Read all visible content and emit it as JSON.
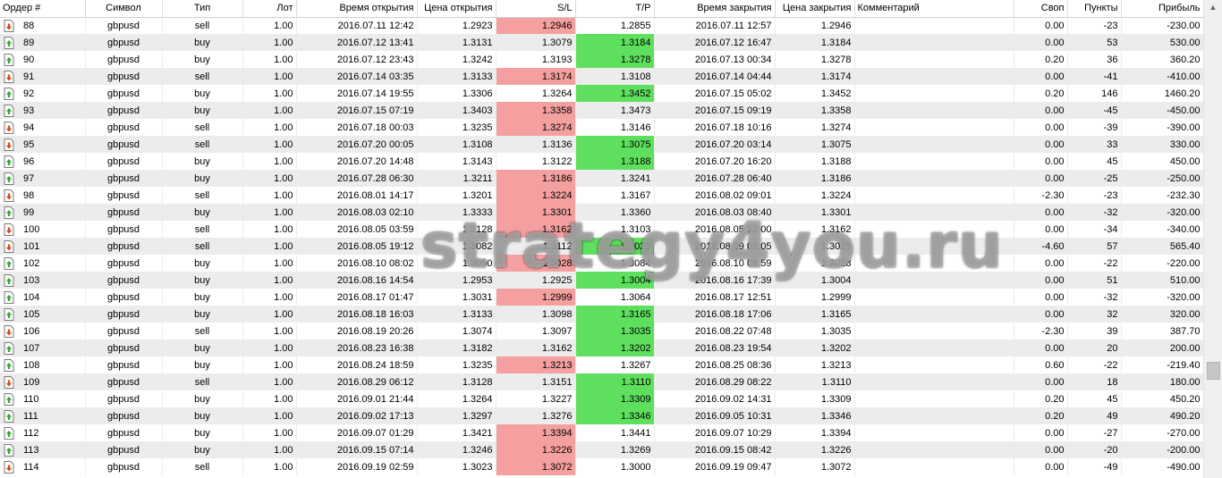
{
  "columns": [
    "Ордер #",
    "Символ",
    "Тип",
    "Лот",
    "Время открытия",
    "Цена открытия",
    "S/L",
    "T/P",
    "Время закрытия",
    "Цена закрытия",
    "Комментарий",
    "Своп",
    "Пункты",
    "Прибыль"
  ],
  "colors": {
    "sl_hit": "#f5a0a0",
    "tp_hit": "#5ee05e",
    "row_alt": "#ececec"
  },
  "icons": {
    "buy": "arrow-up-order-icon",
    "sell": "arrow-down-order-icon"
  },
  "watermark": "strategy4you.ru",
  "rows": [
    {
      "order": "88",
      "symbol": "gbpusd",
      "type": "sell",
      "lot": "1.00",
      "open_time": "2016.07.11 12:42",
      "open_price": "1.2923",
      "sl": "1.2946",
      "tp": "1.2855",
      "close_time": "2016.07.11 12:57",
      "close_price": "1.2946",
      "comment": "",
      "swap": "0.00",
      "points": "-23",
      "profit": "-230.00",
      "hit": "sl"
    },
    {
      "order": "89",
      "symbol": "gbpusd",
      "type": "buy",
      "lot": "1.00",
      "open_time": "2016.07.12 13:41",
      "open_price": "1.3131",
      "sl": "1.3079",
      "tp": "1.3184",
      "close_time": "2016.07.12 16:47",
      "close_price": "1.3184",
      "comment": "",
      "swap": "0.00",
      "points": "53",
      "profit": "530.00",
      "hit": "tp"
    },
    {
      "order": "90",
      "symbol": "gbpusd",
      "type": "buy",
      "lot": "1.00",
      "open_time": "2016.07.12 23:43",
      "open_price": "1.3242",
      "sl": "1.3193",
      "tp": "1.3278",
      "close_time": "2016.07.13 00:34",
      "close_price": "1.3278",
      "comment": "",
      "swap": "0.20",
      "points": "36",
      "profit": "360.20",
      "hit": "tp"
    },
    {
      "order": "91",
      "symbol": "gbpusd",
      "type": "sell",
      "lot": "1.00",
      "open_time": "2016.07.14 03:35",
      "open_price": "1.3133",
      "sl": "1.3174",
      "tp": "1.3108",
      "close_time": "2016.07.14 04:44",
      "close_price": "1.3174",
      "comment": "",
      "swap": "0.00",
      "points": "-41",
      "profit": "-410.00",
      "hit": "sl"
    },
    {
      "order": "92",
      "symbol": "gbpusd",
      "type": "buy",
      "lot": "1.00",
      "open_time": "2016.07.14 19:55",
      "open_price": "1.3306",
      "sl": "1.3264",
      "tp": "1.3452",
      "close_time": "2016.07.15 05:02",
      "close_price": "1.3452",
      "comment": "",
      "swap": "0.20",
      "points": "146",
      "profit": "1460.20",
      "hit": "tp"
    },
    {
      "order": "93",
      "symbol": "gbpusd",
      "type": "buy",
      "lot": "1.00",
      "open_time": "2016.07.15 07:19",
      "open_price": "1.3403",
      "sl": "1.3358",
      "tp": "1.3473",
      "close_time": "2016.07.15 09:19",
      "close_price": "1.3358",
      "comment": "",
      "swap": "0.00",
      "points": "-45",
      "profit": "-450.00",
      "hit": "sl"
    },
    {
      "order": "94",
      "symbol": "gbpusd",
      "type": "sell",
      "lot": "1.00",
      "open_time": "2016.07.18 00:03",
      "open_price": "1.3235",
      "sl": "1.3274",
      "tp": "1.3146",
      "close_time": "2016.07.18 10:16",
      "close_price": "1.3274",
      "comment": "",
      "swap": "0.00",
      "points": "-39",
      "profit": "-390.00",
      "hit": "sl"
    },
    {
      "order": "95",
      "symbol": "gbpusd",
      "type": "sell",
      "lot": "1.00",
      "open_time": "2016.07.20 00:05",
      "open_price": "1.3108",
      "sl": "1.3136",
      "tp": "1.3075",
      "close_time": "2016.07.20 03:14",
      "close_price": "1.3075",
      "comment": "",
      "swap": "0.00",
      "points": "33",
      "profit": "330.00",
      "hit": "tp"
    },
    {
      "order": "96",
      "symbol": "gbpusd",
      "type": "buy",
      "lot": "1.00",
      "open_time": "2016.07.20 14:48",
      "open_price": "1.3143",
      "sl": "1.3122",
      "tp": "1.3188",
      "close_time": "2016.07.20 16:20",
      "close_price": "1.3188",
      "comment": "",
      "swap": "0.00",
      "points": "45",
      "profit": "450.00",
      "hit": "tp"
    },
    {
      "order": "97",
      "symbol": "gbpusd",
      "type": "buy",
      "lot": "1.00",
      "open_time": "2016.07.28 06:30",
      "open_price": "1.3211",
      "sl": "1.3186",
      "tp": "1.3241",
      "close_time": "2016.07.28 06:40",
      "close_price": "1.3186",
      "comment": "",
      "swap": "0.00",
      "points": "-25",
      "profit": "-250.00",
      "hit": "sl"
    },
    {
      "order": "98",
      "symbol": "gbpusd",
      "type": "sell",
      "lot": "1.00",
      "open_time": "2016.08.01 14:17",
      "open_price": "1.3201",
      "sl": "1.3224",
      "tp": "1.3167",
      "close_time": "2016.08.02 09:01",
      "close_price": "1.3224",
      "comment": "",
      "swap": "-2.30",
      "points": "-23",
      "profit": "-232.30",
      "hit": "sl"
    },
    {
      "order": "99",
      "symbol": "gbpusd",
      "type": "buy",
      "lot": "1.00",
      "open_time": "2016.08.03 02:10",
      "open_price": "1.3333",
      "sl": "1.3301",
      "tp": "1.3360",
      "close_time": "2016.08.03 08:40",
      "close_price": "1.3301",
      "comment": "",
      "swap": "0.00",
      "points": "-32",
      "profit": "-320.00",
      "hit": "sl"
    },
    {
      "order": "100",
      "symbol": "gbpusd",
      "type": "sell",
      "lot": "1.00",
      "open_time": "2016.08.05 03:59",
      "open_price": "1.3128",
      "sl": "1.3162",
      "tp": "1.3103",
      "close_time": "2016.08.05 12:00",
      "close_price": "1.3162",
      "comment": "",
      "swap": "0.00",
      "points": "-34",
      "profit": "-340.00",
      "hit": "sl"
    },
    {
      "order": "101",
      "symbol": "gbpusd",
      "type": "sell",
      "lot": "1.00",
      "open_time": "2016.08.05 19:12",
      "open_price": "1.3082",
      "sl": "1.3112",
      "tp": "1.3025",
      "close_time": "2016.08.09 02:05",
      "close_price": "1.3025",
      "comment": "",
      "swap": "-4.60",
      "points": "57",
      "profit": "565.40",
      "hit": "tp"
    },
    {
      "order": "102",
      "symbol": "gbpusd",
      "type": "buy",
      "lot": "1.00",
      "open_time": "2016.08.10 08:02",
      "open_price": "1.3050",
      "sl": "1.3028",
      "tp": "1.3084",
      "close_time": "2016.08.10 08:59",
      "close_price": "1.3028",
      "comment": "",
      "swap": "0.00",
      "points": "-22",
      "profit": "-220.00",
      "hit": "sl"
    },
    {
      "order": "103",
      "symbol": "gbpusd",
      "type": "buy",
      "lot": "1.00",
      "open_time": "2016.08.16 14:54",
      "open_price": "1.2953",
      "sl": "1.2925",
      "tp": "1.3004",
      "close_time": "2016.08.16 17:39",
      "close_price": "1.3004",
      "comment": "",
      "swap": "0.00",
      "points": "51",
      "profit": "510.00",
      "hit": "tp"
    },
    {
      "order": "104",
      "symbol": "gbpusd",
      "type": "buy",
      "lot": "1.00",
      "open_time": "2016.08.17 01:47",
      "open_price": "1.3031",
      "sl": "1.2999",
      "tp": "1.3064",
      "close_time": "2016.08.17 12:51",
      "close_price": "1.2999",
      "comment": "",
      "swap": "0.00",
      "points": "-32",
      "profit": "-320.00",
      "hit": "sl"
    },
    {
      "order": "105",
      "symbol": "gbpusd",
      "type": "buy",
      "lot": "1.00",
      "open_time": "2016.08.18 16:03",
      "open_price": "1.3133",
      "sl": "1.3098",
      "tp": "1.3165",
      "close_time": "2016.08.18 17:06",
      "close_price": "1.3165",
      "comment": "",
      "swap": "0.00",
      "points": "32",
      "profit": "320.00",
      "hit": "tp"
    },
    {
      "order": "106",
      "symbol": "gbpusd",
      "type": "sell",
      "lot": "1.00",
      "open_time": "2016.08.19 20:26",
      "open_price": "1.3074",
      "sl": "1.3097",
      "tp": "1.3035",
      "close_time": "2016.08.22 07:48",
      "close_price": "1.3035",
      "comment": "",
      "swap": "-2.30",
      "points": "39",
      "profit": "387.70",
      "hit": "tp"
    },
    {
      "order": "107",
      "symbol": "gbpusd",
      "type": "buy",
      "lot": "1.00",
      "open_time": "2016.08.23 16:38",
      "open_price": "1.3182",
      "sl": "1.3162",
      "tp": "1.3202",
      "close_time": "2016.08.23 19:54",
      "close_price": "1.3202",
      "comment": "",
      "swap": "0.00",
      "points": "20",
      "profit": "200.00",
      "hit": "tp"
    },
    {
      "order": "108",
      "symbol": "gbpusd",
      "type": "buy",
      "lot": "1.00",
      "open_time": "2016.08.24 18:59",
      "open_price": "1.3235",
      "sl": "1.3213",
      "tp": "1.3267",
      "close_time": "2016.08.25 08:36",
      "close_price": "1.3213",
      "comment": "",
      "swap": "0.60",
      "points": "-22",
      "profit": "-219.40",
      "hit": "sl"
    },
    {
      "order": "109",
      "symbol": "gbpusd",
      "type": "sell",
      "lot": "1.00",
      "open_time": "2016.08.29 06:12",
      "open_price": "1.3128",
      "sl": "1.3151",
      "tp": "1.3110",
      "close_time": "2016.08.29 08:22",
      "close_price": "1.3110",
      "comment": "",
      "swap": "0.00",
      "points": "18",
      "profit": "180.00",
      "hit": "tp"
    },
    {
      "order": "110",
      "symbol": "gbpusd",
      "type": "buy",
      "lot": "1.00",
      "open_time": "2016.09.01 21:44",
      "open_price": "1.3264",
      "sl": "1.3227",
      "tp": "1.3309",
      "close_time": "2016.09.02 14:31",
      "close_price": "1.3309",
      "comment": "",
      "swap": "0.20",
      "points": "45",
      "profit": "450.20",
      "hit": "tp"
    },
    {
      "order": "111",
      "symbol": "gbpusd",
      "type": "buy",
      "lot": "1.00",
      "open_time": "2016.09.02 17:13",
      "open_price": "1.3297",
      "sl": "1.3276",
      "tp": "1.3346",
      "close_time": "2016.09.05 10:31",
      "close_price": "1.3346",
      "comment": "",
      "swap": "0.20",
      "points": "49",
      "profit": "490.20",
      "hit": "tp"
    },
    {
      "order": "112",
      "symbol": "gbpusd",
      "type": "buy",
      "lot": "1.00",
      "open_time": "2016.09.07 01:29",
      "open_price": "1.3421",
      "sl": "1.3394",
      "tp": "1.3441",
      "close_time": "2016.09.07 10:29",
      "close_price": "1.3394",
      "comment": "",
      "swap": "0.00",
      "points": "-27",
      "profit": "-270.00",
      "hit": "sl"
    },
    {
      "order": "113",
      "symbol": "gbpusd",
      "type": "buy",
      "lot": "1.00",
      "open_time": "2016.09.15 07:14",
      "open_price": "1.3246",
      "sl": "1.3226",
      "tp": "1.3269",
      "close_time": "2016.09.15 08:42",
      "close_price": "1.3226",
      "comment": "",
      "swap": "0.00",
      "points": "-20",
      "profit": "-200.00",
      "hit": "sl"
    },
    {
      "order": "114",
      "symbol": "gbpusd",
      "type": "sell",
      "lot": "1.00",
      "open_time": "2016.09.19 02:59",
      "open_price": "1.3023",
      "sl": "1.3072",
      "tp": "1.3000",
      "close_time": "2016.09.19 09:47",
      "close_price": "1.3072",
      "comment": "",
      "swap": "0.00",
      "points": "-49",
      "profit": "-490.00",
      "hit": "sl"
    }
  ]
}
